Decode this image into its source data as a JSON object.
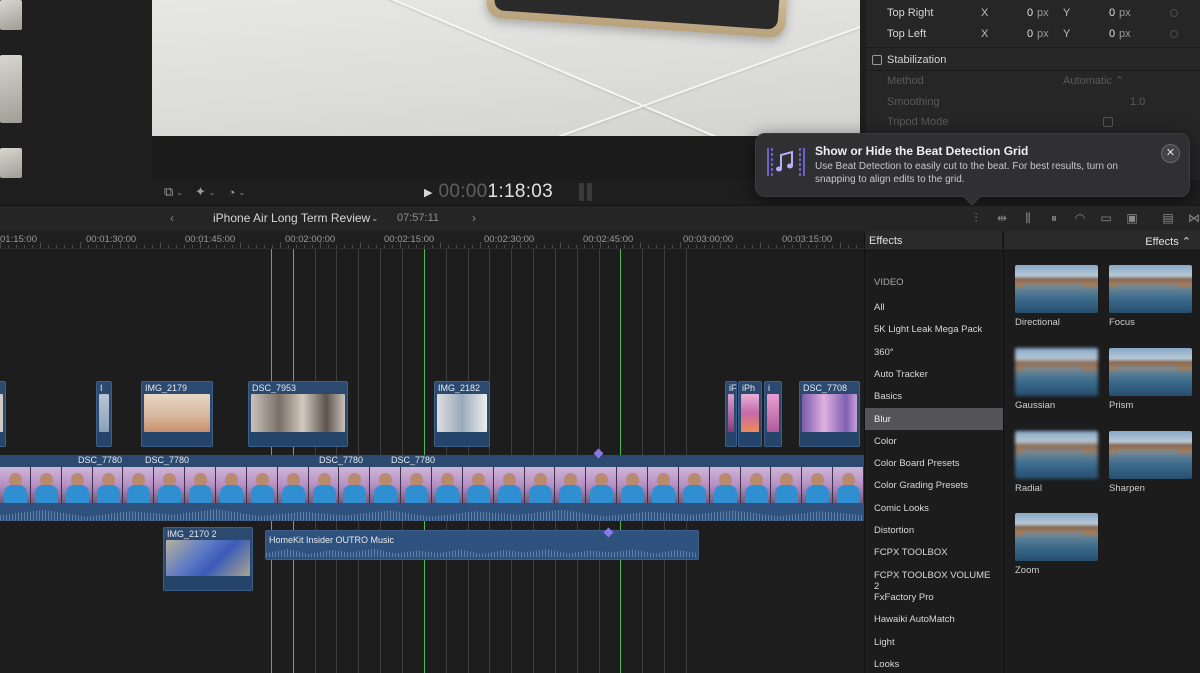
{
  "viewer": {
    "timecode_dim": "00:00",
    "timecode": "1:18:03"
  },
  "inspector": {
    "rows": [
      {
        "label": "Top Right",
        "x_label": "X",
        "x_val": "0",
        "x_unit": "px",
        "y_label": "Y",
        "y_val": "0",
        "y_unit": "px"
      },
      {
        "label": "Top Left",
        "x_label": "X",
        "x_val": "0",
        "x_unit": "px",
        "y_label": "Y",
        "y_val": "0",
        "y_unit": "px"
      }
    ],
    "stabilization_label": "Stabilization",
    "method_label": "Method",
    "method_value": "Automatic ⌃",
    "smoothing_label": "Smoothing",
    "smoothing_value": "1.0",
    "tripod_label": "Tripod Mode"
  },
  "notification": {
    "title": "Show or Hide the Beat Detection Grid",
    "body": "Use Beat Detection to easily cut to the beat. For best results, turn on snapping to align edits to the grid.",
    "close": "✕"
  },
  "timeline_header": {
    "prev": "‹",
    "next": "›",
    "project_name": "iPhone Air Long Term Review",
    "project_chevron": "⌄",
    "duration": "07:57:11"
  },
  "ruler": {
    "labels": [
      "01:15:00",
      "00:01:30:00",
      "00:01:45:00",
      "00:02:00:00",
      "00:02:15:00",
      "00:02:30:00",
      "00:02:45:00",
      "00:03:00:00",
      "00:03:15:00"
    ]
  },
  "clips": {
    "upper": [
      {
        "name": ""
      },
      {
        "name": "I"
      },
      {
        "name": "IMG_2179"
      },
      {
        "name": "DSC_7953"
      },
      {
        "name": "IMG_2182"
      },
      {
        "name": "iF"
      },
      {
        "name": "iPh"
      },
      {
        "name": "i"
      },
      {
        "name": "DSC_7708"
      }
    ],
    "primary_labels": [
      "DSC_7780",
      "DSC_7780",
      "DSC_7780",
      "DSC_7780"
    ],
    "lower_clip": "IMG_2170 2",
    "music": "HomeKit Insider OUTRO Music"
  },
  "effects": {
    "header_left": "Effects",
    "header_right": "Effects ⌃",
    "categories": [
      "VIDEO",
      "All",
      "5K Light Leak Mega Pack",
      "360°",
      "Auto Tracker",
      "Basics",
      "Blur",
      "Color",
      "Color Board Presets",
      "Color Grading Presets",
      "Comic Looks",
      "Distortion",
      "FCPX TOOLBOX",
      "FCPX TOOLBOX VOLUME 2",
      "FxFactory Pro",
      "Hawaiki AutoMatch",
      "Light",
      "Looks"
    ],
    "selected": "Blur",
    "tiles": [
      "Directional",
      "Focus",
      "Gaussian",
      "Prism",
      "Radial",
      "Sharpen",
      "Zoom"
    ]
  },
  "colors": {
    "beat_green": "#4fb85b",
    "clip_blue": "#2c4a70",
    "marker_purple": "#8a78e8",
    "accent_purple": "#7c6cf0"
  }
}
